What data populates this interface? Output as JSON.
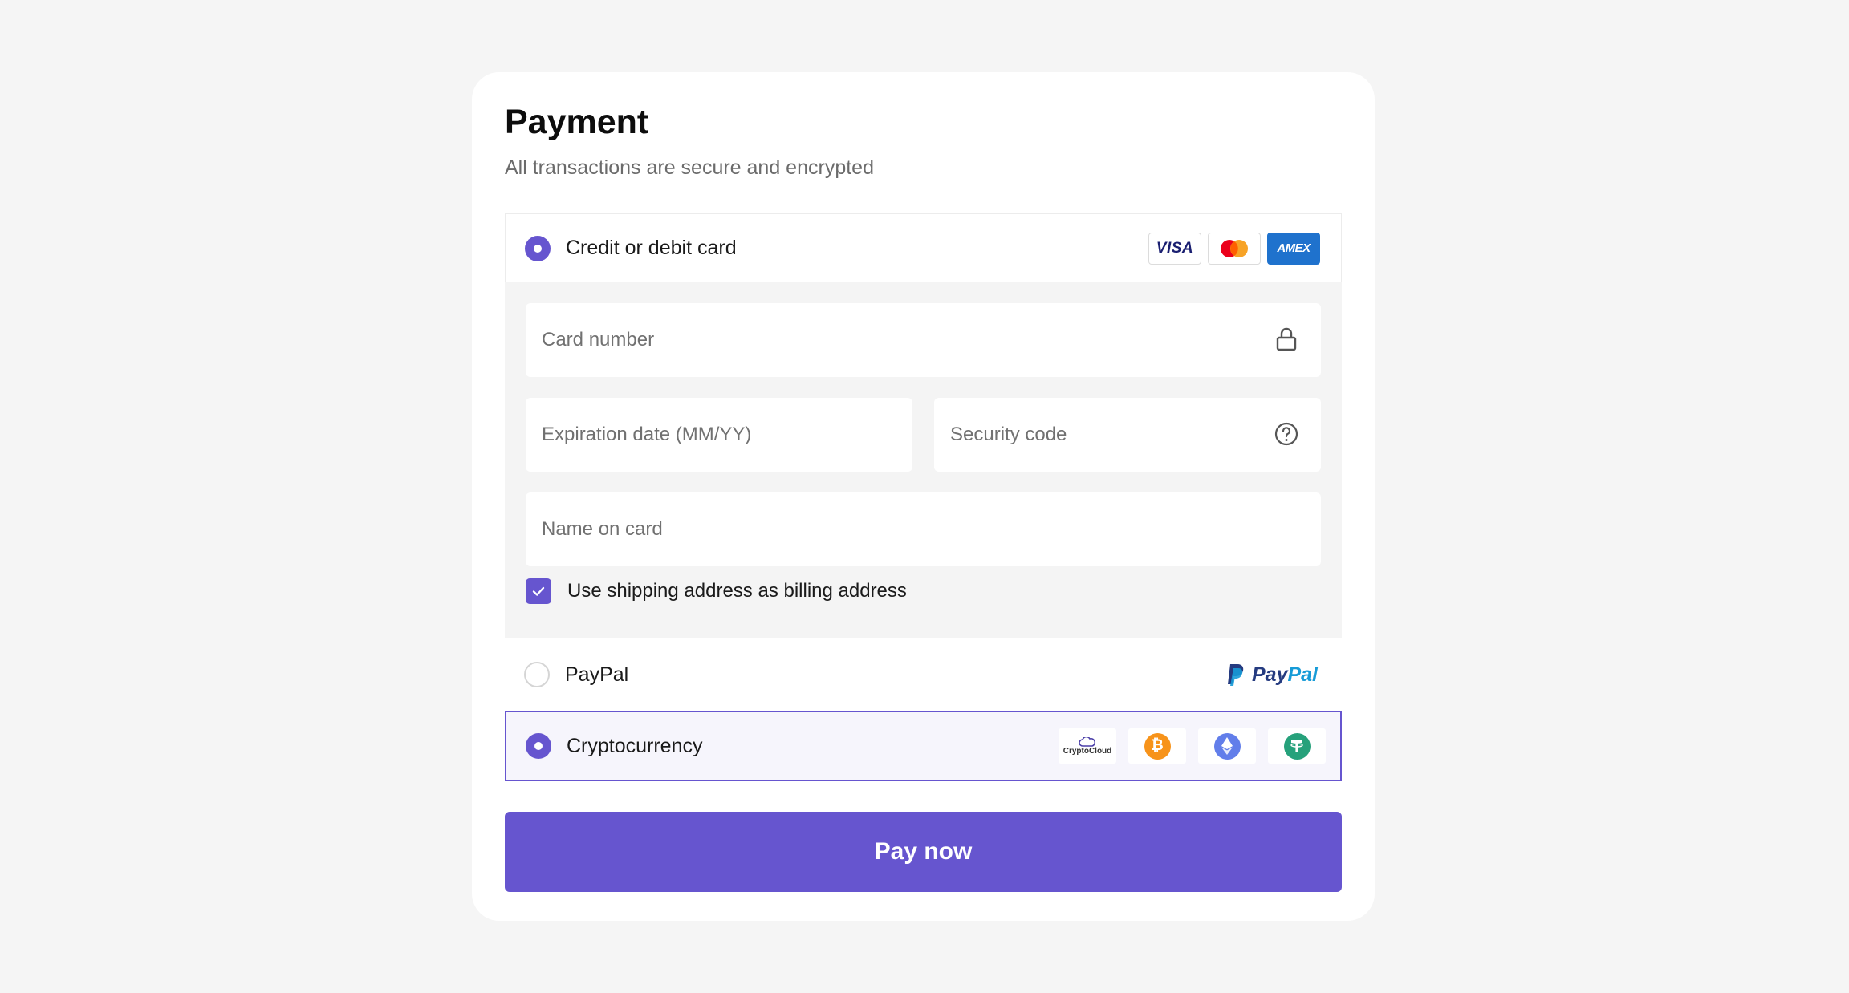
{
  "header": {
    "title": "Payment",
    "subtitle": "All transactions are secure and encrypted"
  },
  "methods": {
    "card": {
      "label": "Credit or debit card",
      "selected": true,
      "brands": [
        "VISA",
        "mastercard-logo",
        "AMEX"
      ]
    },
    "paypal": {
      "label": "PayPal",
      "selected": false,
      "logo_text": "PayPal"
    },
    "crypto": {
      "label": "Cryptocurrency",
      "selected": true,
      "logos": [
        "CryptoCloud",
        "bitcoin-icon",
        "ethereum-icon",
        "tether-icon"
      ]
    }
  },
  "card_form": {
    "card_number_placeholder": "Card number",
    "expiration_placeholder": "Expiration date (MM/YY)",
    "security_code_placeholder": "Security code",
    "name_placeholder": "Name on card",
    "billing_checkbox_label": "Use shipping address as billing address",
    "billing_checked": true
  },
  "actions": {
    "pay_label": "Pay now"
  },
  "colors": {
    "accent": "#6655cf",
    "page_bg": "#f5f5f5",
    "form_bg": "#f4f4f4"
  }
}
